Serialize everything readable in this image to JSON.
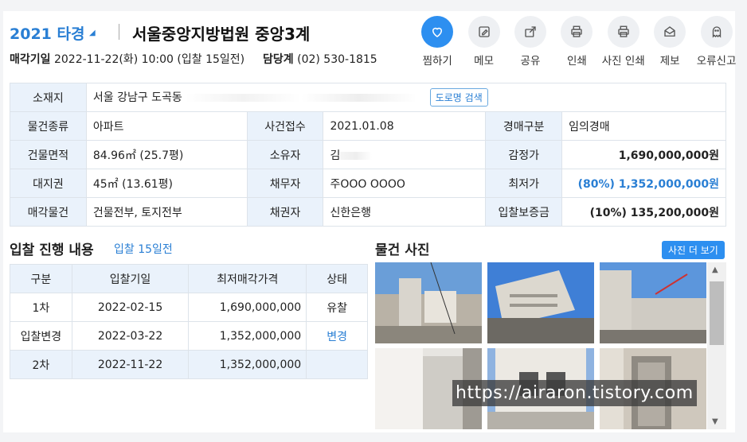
{
  "header": {
    "case_no": "2021 타경",
    "court": "서울중앙지방법원 중앙3계",
    "sale_date_label": "매각기일",
    "sale_date_value": "2022-11-22(화) 10:00 (입찰 15일전)",
    "dept_label": "담당계",
    "dept_value": "(02) 530-1815"
  },
  "actions": [
    {
      "label": "찜하기",
      "icon": "heart-icon"
    },
    {
      "label": "메모",
      "icon": "memo-icon"
    },
    {
      "label": "공유",
      "icon": "share-icon"
    },
    {
      "label": "인쇄",
      "icon": "print-icon"
    },
    {
      "label": "사진 인쇄",
      "icon": "photo-print-icon"
    },
    {
      "label": "제보",
      "icon": "report-icon"
    },
    {
      "label": "오류신고",
      "icon": "ghost-icon"
    }
  ],
  "info": {
    "address_label": "소재지",
    "address_value": "서울 강남구 도곡동",
    "road_button": "도로명 검색",
    "type_label": "물건종류",
    "type_value": "아파트",
    "filed_label": "사건접수",
    "filed_value": "2021.01.08",
    "auction_type_label": "경매구분",
    "auction_type_value": "임의경매",
    "area_label": "건물면적",
    "area_value": "84.96㎡ (25.7평)",
    "owner_label": "소유자",
    "owner_value": "김",
    "appraisal_label": "감정가",
    "appraisal_value": "1,690,000,000원",
    "land_label": "대지권",
    "land_value": "45㎡ (13.61평)",
    "debtor_label": "채무자",
    "debtor_value": "주OOO OOOO",
    "min_label": "최저가",
    "min_value": "(80%) 1,352,000,000원",
    "sale_obj_label": "매각물건",
    "sale_obj_value": "건물전부, 토지전부",
    "creditor_label": "채권자",
    "creditor_value": "신한은행",
    "deposit_label": "입찰보증금",
    "deposit_value": "(10%) 135,200,000원"
  },
  "bidding": {
    "title": "입찰 진행 내용",
    "subtitle": "입찰 15일전",
    "columns": [
      "구분",
      "입찰기일",
      "최저매각가격",
      "상태"
    ],
    "rows": [
      [
        "1차",
        "2022-02-15",
        "1,690,000,000",
        "유찰"
      ],
      [
        "입찰변경",
        "2022-03-22",
        "1,352,000,000",
        "변경"
      ],
      [
        "2차",
        "2022-11-22",
        "1,352,000,000",
        ""
      ]
    ]
  },
  "photos": {
    "title": "물건 사진",
    "more_button": "사진 더 보기",
    "watermark": "https://airaron.tistory.com"
  },
  "colors": {
    "accent": "#2d8ff0",
    "link": "#2a7fd4",
    "header_cell": "#eaf2fb",
    "border": "#dde3ea"
  }
}
